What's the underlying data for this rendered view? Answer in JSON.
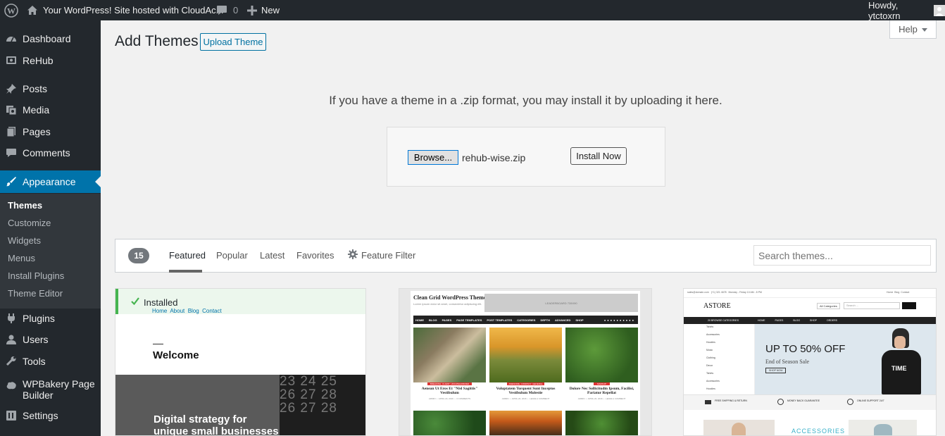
{
  "admin_bar": {
    "site_name": "Your WordPress! Site hosted with CloudAc...",
    "comments_count": "0",
    "new_label": "New",
    "greeting": "Howdy, ytctoxrn"
  },
  "sidebar": {
    "items": [
      {
        "label": "Dashboard",
        "icon": "dashboard-icon"
      },
      {
        "label": "ReHub",
        "icon": "rehub-icon"
      },
      {
        "label": "Posts",
        "icon": "pin-icon"
      },
      {
        "label": "Media",
        "icon": "media-icon"
      },
      {
        "label": "Pages",
        "icon": "pages-icon"
      },
      {
        "label": "Comments",
        "icon": "comments-icon"
      },
      {
        "label": "Appearance",
        "icon": "brush-icon"
      },
      {
        "label": "Plugins",
        "icon": "plug-icon"
      },
      {
        "label": "Users",
        "icon": "users-icon"
      },
      {
        "label": "Tools",
        "icon": "wrench-icon"
      },
      {
        "label": "WPBakery Page Builder",
        "icon": "wpbakery-icon"
      },
      {
        "label": "Settings",
        "icon": "settings-icon"
      }
    ],
    "submenu": [
      "Themes",
      "Customize",
      "Widgets",
      "Menus",
      "Install Plugins",
      "Theme Editor"
    ]
  },
  "main": {
    "title": "Add Themes",
    "upload_button": "Upload Theme",
    "help_label": "Help",
    "upload_message": "If you have a theme in a .zip format, you may install it by uploading it here.",
    "browse_label": "Browse...",
    "file_name": "rehub-wise.zip",
    "install_label": "Install Now"
  },
  "filter": {
    "count": "15",
    "tabs": [
      "Featured",
      "Popular",
      "Latest",
      "Favorites"
    ],
    "feature_filter": "Feature Filter",
    "search_placeholder": "Search themes..."
  },
  "themes": [
    {
      "status": "Installed",
      "nav": "Home  About  Blog  Contact",
      "welcome": "Welcome",
      "headline_line1": "Digital strategy for",
      "headline_line2": "unique small businesses",
      "calendar": "23 24 25\n26 27 28\n26 27 28"
    },
    {
      "site_title": "Clean Grid WordPress Theme",
      "site_tagline": "Lorem ipsum dolor sit amet, consectetur adipiscing elit.",
      "leaderboard": "LEADERBOARD 728X90",
      "nav": [
        "HOME",
        "BLOG",
        "PAGES",
        "PAGE TEMPLATES",
        "POST TEMPLATES",
        "CATEGORIES",
        "DEPTH",
        "ADVANCED",
        "SHOP"
      ],
      "posts": [
        {
          "tags": "BREAKING  CLIENT  UNCATEGORIZED",
          "title": "Aenean Ut Eros Et \"Nisl Sagittis\" Vestibulum",
          "meta": "ADMIN  •  APRIL 20, 2016  •  3 COMMENTS"
        },
        {
          "tags": "AWESOME  COMPANY  GENERAL",
          "title": "Voluptatem Torquent Sunt Inceptos Vestibulum Molestie",
          "meta": "ADMIN  •  APRIL 20, 2016  •  LEAVE A COMMENT"
        },
        {
          "tags": "MARKUP",
          "title": "Dolore Nec Sollicitudin Ipsum, Facilisi, Pariatur Repellat",
          "meta": "ADMIN  •  APRIL 20, 2016  •  LEAVE A COMMENT"
        }
      ]
    },
    {
      "topbar_left": "sales@domain.com   (+1) 321 4678   Monday - Friday 10 AM - 8 PM",
      "topbar_right": "Home  Blog  Contact",
      "logo": "ASTORE",
      "categories_label": "All Categories",
      "search_placeholder": "Search ...",
      "browse_categories": "20 BROWSE CATEGORIES",
      "nav": [
        "HOME",
        "PAGES",
        "BLOG",
        "SHOP",
        "ORDERS"
      ],
      "side_categories": [
        "Tshirts",
        "Accessories",
        "Hoodies",
        "Music",
        "Clothing",
        "Decor",
        "Tshirts",
        "Accessories",
        "Hoodies"
      ],
      "promo_title": "UP TO 50% OFF",
      "promo_sub": "End of Season Sale",
      "promo_button": "SHOP NOW",
      "features": [
        "FREE SHIPPING & RETURN",
        "MONEY BACK GUARANTEE",
        "ONLINE SUPPORT 24/7"
      ],
      "section_label": "ACCESSORIES"
    }
  ]
}
